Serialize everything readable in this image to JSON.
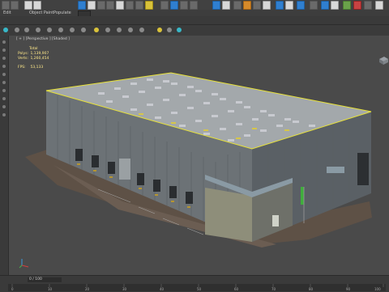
{
  "menu": {
    "items": [
      "Edit",
      "Object Paint",
      "Populate"
    ]
  },
  "viewport": {
    "label": "[ + ] [Perspective ] [Shaded ]",
    "stats": {
      "header": "Total",
      "polys_label": "Polys:",
      "polys_value": "1,139,907",
      "verts_label": "Verts:",
      "verts_value": "1,260,454",
      "fps_label": "FPS:",
      "fps_value": "53,133"
    }
  },
  "timeline": {
    "frame_label": "0 / 100",
    "ticks": [
      "0",
      "10",
      "20",
      "30",
      "40",
      "50",
      "60",
      "70",
      "80",
      "90",
      "100"
    ]
  },
  "colors": {
    "viewport_bg": "#4a4a4a",
    "selection": "#e8e23a",
    "stats_text": "#ffe98a"
  }
}
